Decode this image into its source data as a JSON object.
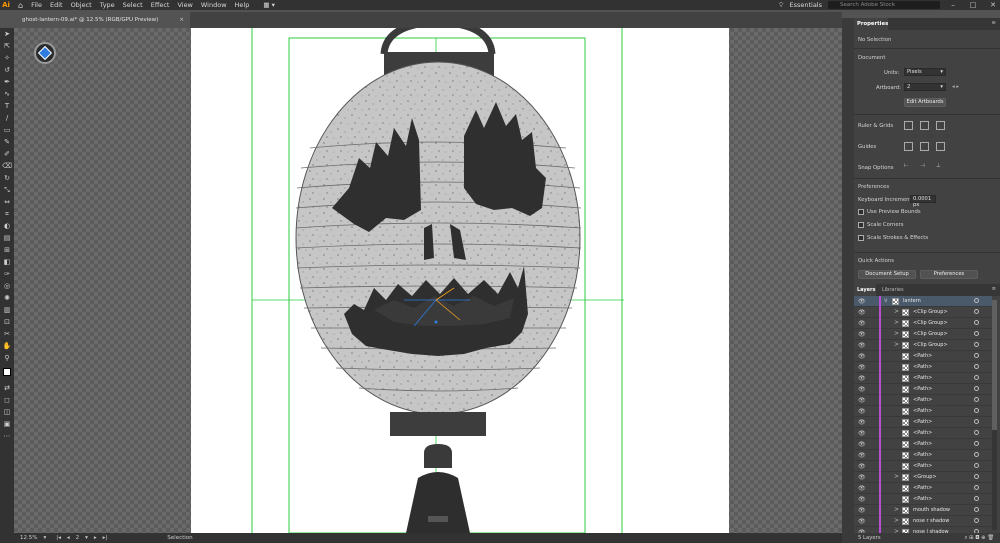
{
  "app": {
    "logo": "Ai"
  },
  "menu": [
    "File",
    "Edit",
    "Object",
    "Type",
    "Select",
    "Effect",
    "View",
    "Window",
    "Help"
  ],
  "workspace": "Essentials",
  "search_placeholder": "Search Adobe Stock",
  "document_tab": {
    "title": "ghost-lantern-09.ai* @ 12.5% (RGB/GPU Preview)",
    "close": "×"
  },
  "status": {
    "zoom": "12.5%",
    "artboard_index": "2",
    "tool": "Selection"
  },
  "properties": {
    "tab_label": "Properties",
    "selection": "No Selection",
    "document_heading": "Document",
    "units_label": "Units:",
    "units_value": "Pixels",
    "artboard_label": "Artboard:",
    "artboard_value": "2",
    "edit_artboards": "Edit Artboards",
    "ruler_grids": "Ruler & Grids",
    "guides": "Guides",
    "snap_options": "Snap Options",
    "preferences_heading": "Preferences",
    "keyboard_increment_label": "Keyboard Increment:",
    "keyboard_increment_value": "0.0001 px",
    "use_preview_bounds": "Use Preview Bounds",
    "scale_corners": "Scale Corners",
    "scale_strokes": "Scale Strokes & Effects",
    "quick_actions": "Quick Actions",
    "document_setup": "Document Setup",
    "preferences_button": "Preferences"
  },
  "layers": {
    "tab_label": "Layers",
    "libraries_label": "Libraries",
    "footer": "5 Layers",
    "rows": [
      {
        "name": "lantern",
        "chevron": "v"
      },
      {
        "name": "<Clip Group>",
        "chevron": ">"
      },
      {
        "name": "<Clip Group>",
        "chevron": ">"
      },
      {
        "name": "<Clip Group>",
        "chevron": ">"
      },
      {
        "name": "<Clip Group>",
        "chevron": ">"
      },
      {
        "name": "<Path>",
        "chevron": ""
      },
      {
        "name": "<Path>",
        "chevron": ""
      },
      {
        "name": "<Path>",
        "chevron": ""
      },
      {
        "name": "<Path>",
        "chevron": ""
      },
      {
        "name": "<Path>",
        "chevron": ""
      },
      {
        "name": "<Path>",
        "chevron": ""
      },
      {
        "name": "<Path>",
        "chevron": ""
      },
      {
        "name": "<Path>",
        "chevron": ""
      },
      {
        "name": "<Path>",
        "chevron": ""
      },
      {
        "name": "<Path>",
        "chevron": ""
      },
      {
        "name": "<Path>",
        "chevron": ""
      },
      {
        "name": "<Group>",
        "chevron": ">"
      },
      {
        "name": "<Path>",
        "chevron": ""
      },
      {
        "name": "<Path>",
        "chevron": ""
      },
      {
        "name": "mouth shadow",
        "chevron": ">"
      },
      {
        "name": "nose r shadow",
        "chevron": ">"
      },
      {
        "name": "nose l shadow",
        "chevron": ">"
      }
    ]
  },
  "colors": {
    "accent": "#2f7de0",
    "layer_bar": "#b84fd0",
    "guide": "#2ecc40",
    "lantern": "#c4c4c4",
    "dark": "#333333"
  }
}
